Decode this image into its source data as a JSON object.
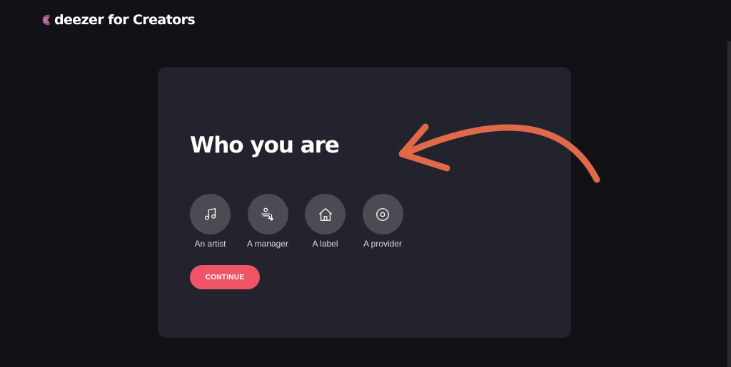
{
  "header": {
    "logo_text": "deezer for Creators"
  },
  "card": {
    "title": "Who you are",
    "options": [
      {
        "label": "An artist",
        "icon": "music-note-icon"
      },
      {
        "label": "A manager",
        "icon": "manager-icon"
      },
      {
        "label": "A label",
        "icon": "home-icon"
      },
      {
        "label": "A provider",
        "icon": "disc-icon"
      }
    ],
    "continue_label": "CONTINUE"
  },
  "colors": {
    "background": "#121216",
    "card": "#23232d",
    "option_circle": "#4b4b54",
    "continue_button": "#ef5466",
    "annotation_arrow": "#e0694a"
  }
}
